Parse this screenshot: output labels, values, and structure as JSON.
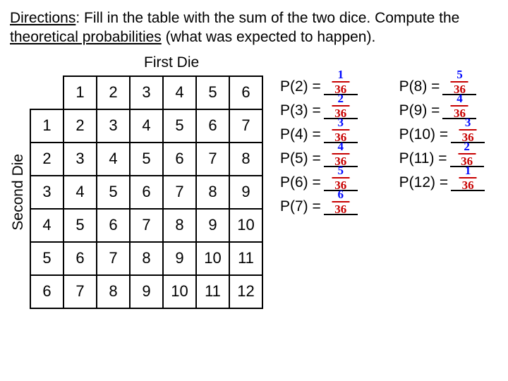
{
  "directions_label": "Directions",
  "directions_text1": ":  Fill in the table with the sum of the two dice.  Compute the ",
  "directions_text2": "theoretical probabilities",
  "directions_text3": " (what was expected to happen).",
  "first_die_label": "First Die",
  "second_die_label": "Second Die",
  "table": {
    "col_headers": [
      "1",
      "2",
      "3",
      "4",
      "5",
      "6"
    ],
    "row_headers": [
      "1",
      "2",
      "3",
      "4",
      "5",
      "6"
    ],
    "cells": [
      [
        "2",
        "3",
        "4",
        "5",
        "6",
        "7"
      ],
      [
        "3",
        "4",
        "5",
        "6",
        "7",
        "8"
      ],
      [
        "4",
        "5",
        "6",
        "7",
        "8",
        "9"
      ],
      [
        "5",
        "6",
        "7",
        "8",
        "9",
        "10"
      ],
      [
        "6",
        "7",
        "8",
        "9",
        "10",
        "11"
      ],
      [
        "7",
        "8",
        "9",
        "10",
        "11",
        "12"
      ]
    ]
  },
  "probs": [
    {
      "label": "P(2) =",
      "num": "1",
      "den": "36"
    },
    {
      "label": "P(8) =",
      "num": "5",
      "den": "36"
    },
    {
      "label": "P(3) =",
      "num": "2",
      "den": "36"
    },
    {
      "label": "P(9) =",
      "num": "4",
      "den": "36"
    },
    {
      "label": "P(4) =",
      "num": "3",
      "den": "36"
    },
    {
      "label": "P(10) =",
      "num": "3",
      "den": "36"
    },
    {
      "label": "P(5) =",
      "num": "4",
      "den": "36"
    },
    {
      "label": "P(11) =",
      "num": "2",
      "den": "36"
    },
    {
      "label": "P(6) =",
      "num": "5",
      "den": "36"
    },
    {
      "label": "P(12) =",
      "num": "1",
      "den": "36"
    },
    {
      "label": "P(7) =",
      "num": "6",
      "den": "36"
    }
  ]
}
